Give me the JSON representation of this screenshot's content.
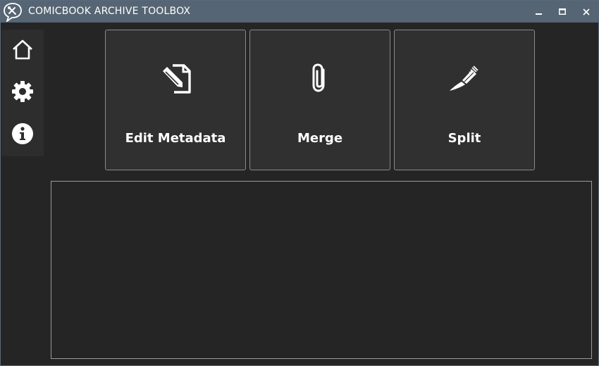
{
  "window": {
    "title": "COMICBOOK ARCHIVE TOOLBOX",
    "app_icon": "speech-bubble-tools-icon",
    "controls": [
      {
        "name": "minimize",
        "icon": "minimize-icon"
      },
      {
        "name": "maximize",
        "icon": "maximize-icon"
      },
      {
        "name": "close",
        "icon": "close-icon"
      }
    ]
  },
  "sidebar": {
    "items": [
      {
        "name": "home",
        "icon": "home-icon"
      },
      {
        "name": "settings",
        "icon": "gear-icon"
      },
      {
        "name": "about",
        "icon": "info-icon"
      }
    ]
  },
  "tools": [
    {
      "label": "Edit Metadata",
      "icon": "edit-document-icon"
    },
    {
      "label": "Merge",
      "icon": "paperclip-icon"
    },
    {
      "label": "Split",
      "icon": "scalpel-icon"
    }
  ],
  "log_panel": {
    "text": ""
  },
  "colors": {
    "titlebar": "#566573",
    "background": "#252525",
    "sidebar": "#2d2d2d",
    "tile": "#303030",
    "text": "#ffffff"
  }
}
